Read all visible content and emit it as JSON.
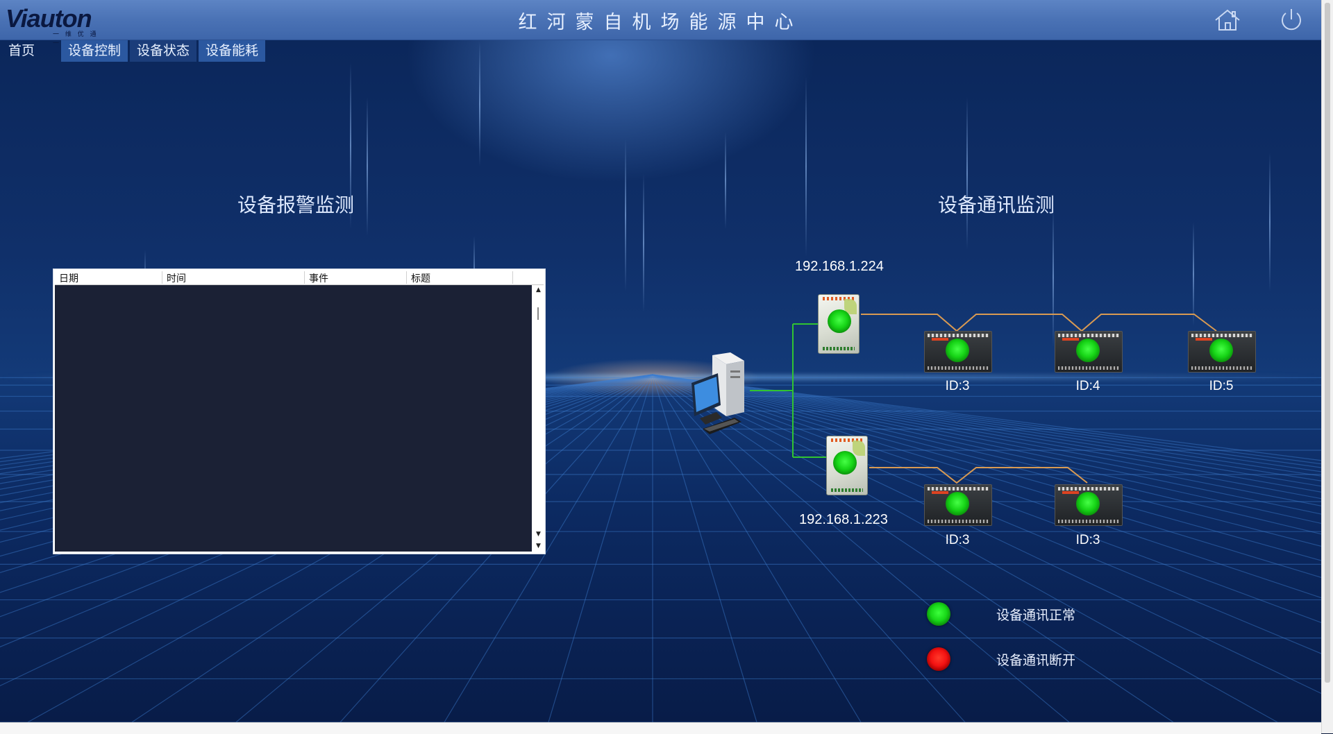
{
  "header": {
    "logo_text": "Viauton",
    "logo_sub": "一 维 优 通 一",
    "title": "红河蒙自机场能源中心",
    "home_icon": "home-icon",
    "power_icon": "power-icon"
  },
  "nav": {
    "items": [
      {
        "label": "首页"
      },
      {
        "label": "设备控制"
      },
      {
        "label": "设备状态"
      },
      {
        "label": "设备能耗"
      }
    ],
    "active_index": 2
  },
  "alarm": {
    "title": "设备报警监测",
    "columns": [
      "日期",
      "时间",
      "事件",
      "标题"
    ],
    "rows": []
  },
  "comm": {
    "title": "设备通讯监测",
    "gateways": [
      {
        "ip": "192.168.1.224",
        "status": "normal",
        "devices": [
          {
            "id": "ID:3",
            "status": "normal"
          },
          {
            "id": "ID:4",
            "status": "normal"
          },
          {
            "id": "ID:5",
            "status": "normal"
          }
        ]
      },
      {
        "ip": "192.168.1.223",
        "status": "normal",
        "devices": [
          {
            "id": "ID:3",
            "status": "normal"
          },
          {
            "id": "ID:3",
            "status": "normal"
          }
        ]
      }
    ]
  },
  "legend": {
    "normal_label": "设备通讯正常",
    "disconnected_label": "设备通讯断开",
    "normal_color": "#18d818",
    "disconnected_color": "#f31212"
  }
}
